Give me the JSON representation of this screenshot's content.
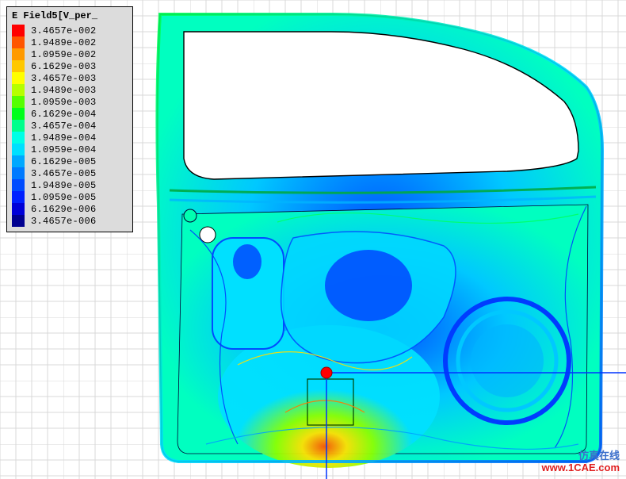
{
  "legend": {
    "title": "E Field5[V_per_",
    "entries": [
      {
        "color": "#ff0000",
        "label": "3.4657e-002"
      },
      {
        "color": "#ff5500",
        "label": "1.9489e-002"
      },
      {
        "color": "#ff9a00",
        "label": "1.0959e-002"
      },
      {
        "color": "#ffc800",
        "label": "6.1629e-003"
      },
      {
        "color": "#ffff00",
        "label": "3.4657e-003"
      },
      {
        "color": "#b6ff00",
        "label": "1.9489e-003"
      },
      {
        "color": "#55ff00",
        "label": "1.0959e-003"
      },
      {
        "color": "#00ff1a",
        "label": "6.1629e-004"
      },
      {
        "color": "#00ff8c",
        "label": "3.4657e-004"
      },
      {
        "color": "#00ffe6",
        "label": "1.9489e-004"
      },
      {
        "color": "#00e0ff",
        "label": "1.0959e-004"
      },
      {
        "color": "#00a8ff",
        "label": "6.1629e-005"
      },
      {
        "color": "#007aff",
        "label": "3.4657e-005"
      },
      {
        "color": "#004cff",
        "label": "1.9489e-005"
      },
      {
        "color": "#0020ff",
        "label": "1.0959e-005"
      },
      {
        "color": "#0000d8",
        "label": "6.1629e-006"
      },
      {
        "color": "#000090",
        "label": "3.4657e-006"
      }
    ]
  },
  "watermark": {
    "line1": "仿真在线",
    "line2": "www.1CAE.com"
  }
}
